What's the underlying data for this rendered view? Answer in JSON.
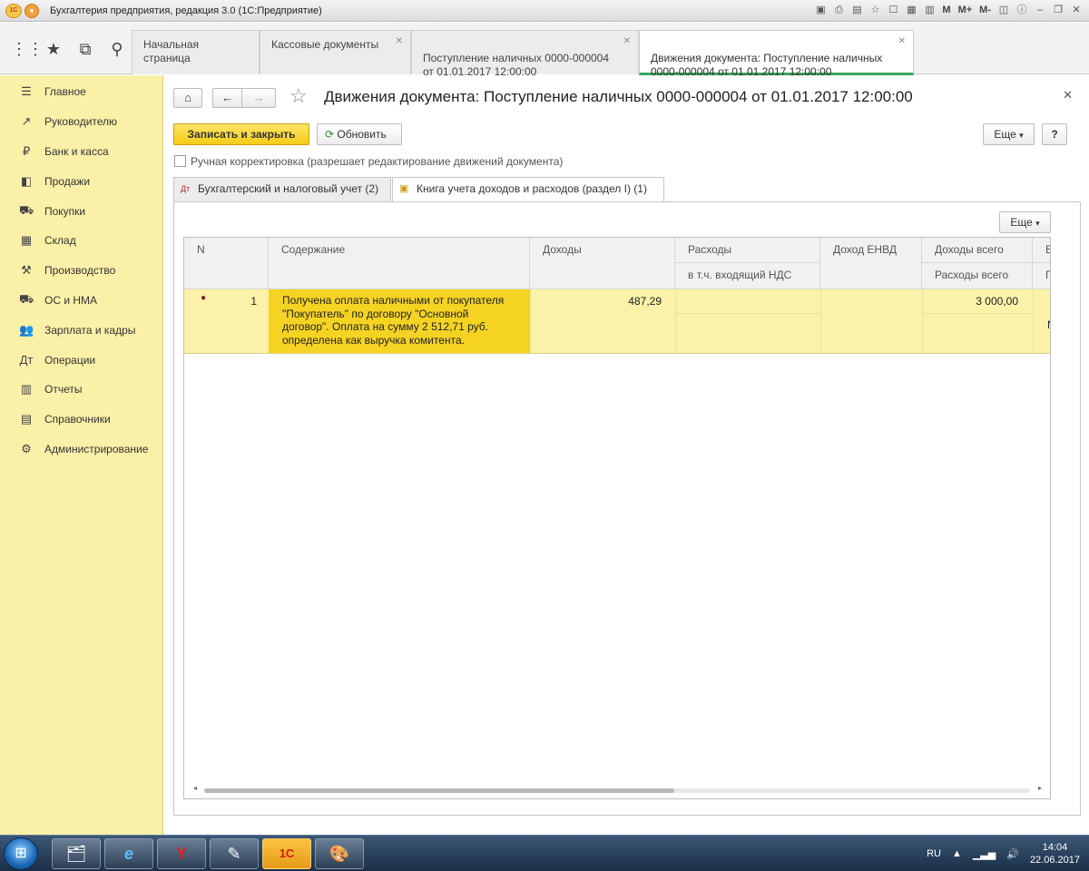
{
  "window": {
    "title": "Бухгалтерия предприятия, редакция 3.0  (1С:Предприятие)",
    "logo": "1С",
    "tool_m": "M",
    "tool_mplus": "M+",
    "tool_mminus": "M-"
  },
  "top_tabs": [
    {
      "label": "Начальная страница"
    },
    {
      "label": "Кассовые документы"
    },
    {
      "label": "Поступление наличных 0000-000004\nот 01.01.2017 12:00:00"
    },
    {
      "label": "Движения документа: Поступление наличных\n0000-000004 от 01.01.2017 12:00:00"
    }
  ],
  "sidebar": {
    "items": [
      {
        "label": "Главное",
        "icon": "menu-lines-icon"
      },
      {
        "label": "Руководителю",
        "icon": "trend-chart-icon"
      },
      {
        "label": "Банк и касса",
        "icon": "ruble-icon"
      },
      {
        "label": "Продажи",
        "icon": "shopping-bag-icon"
      },
      {
        "label": "Покупки",
        "icon": "cart-icon"
      },
      {
        "label": "Склад",
        "icon": "warehouse-icon"
      },
      {
        "label": "Производство",
        "icon": "factory-icon"
      },
      {
        "label": "ОС и НМА",
        "icon": "truck-icon"
      },
      {
        "label": "Зарплата и кадры",
        "icon": "people-icon"
      },
      {
        "label": "Операции",
        "icon": "operations-icon"
      },
      {
        "label": "Отчеты",
        "icon": "report-chart-icon"
      },
      {
        "label": "Справочники",
        "icon": "book-icon"
      },
      {
        "label": "Администрирование",
        "icon": "gear-icon"
      }
    ]
  },
  "document": {
    "title": "Движения документа: Поступление наличных 0000-000004 от 01.01.2017 12:00:00",
    "save_close_label": "Записать и закрыть",
    "refresh_label": "Обновить",
    "more_label": "Еще",
    "help_label": "?",
    "manual_correction_label": "Ручная корректировка (разрешает редактирование движений документа)"
  },
  "form_tabs": [
    {
      "label": "Бухгалтерский и налоговый учет (2)",
      "icon": "accounting-icon"
    },
    {
      "label": "Книга учета доходов и расходов (раздел I) (1)",
      "icon": "ledger-book-icon"
    }
  ],
  "grid": {
    "more_label": "Еще",
    "headers": {
      "n": "N",
      "content": "Содержание",
      "income": "Доходы",
      "expenses": "Расходы",
      "vat_incl": "в т.ч. входящий НДС",
      "envd_income": "Доход ЕНВД",
      "income_total": "Доходы всего",
      "expenses_total": "Расходы всего",
      "cut1": "В",
      "cut2": "П"
    },
    "rows": [
      {
        "n": "1",
        "content": "Получена оплата наличными от покупателя \"Покупатель\" по договору \"Основной договор\". Оплата на сумму 2 512,71 руб. определена как выручка комитента.",
        "income": "487,29",
        "income_total": "3 000,00",
        "cut2": "N"
      }
    ]
  },
  "taskbar": {
    "lang": "RU",
    "time": "14:04",
    "date": "22.06.2017",
    "apps": [
      {
        "icon": "explorer-icon",
        "glyph": "🗂"
      },
      {
        "icon": "internet-explorer-icon",
        "glyph": "e"
      },
      {
        "icon": "yandex-browser-icon",
        "glyph": "Y"
      },
      {
        "icon": "notes-icon",
        "glyph": "✎"
      },
      {
        "icon": "1c-icon",
        "glyph": "1С"
      },
      {
        "icon": "paint-icon",
        "glyph": "🎨"
      }
    ]
  }
}
